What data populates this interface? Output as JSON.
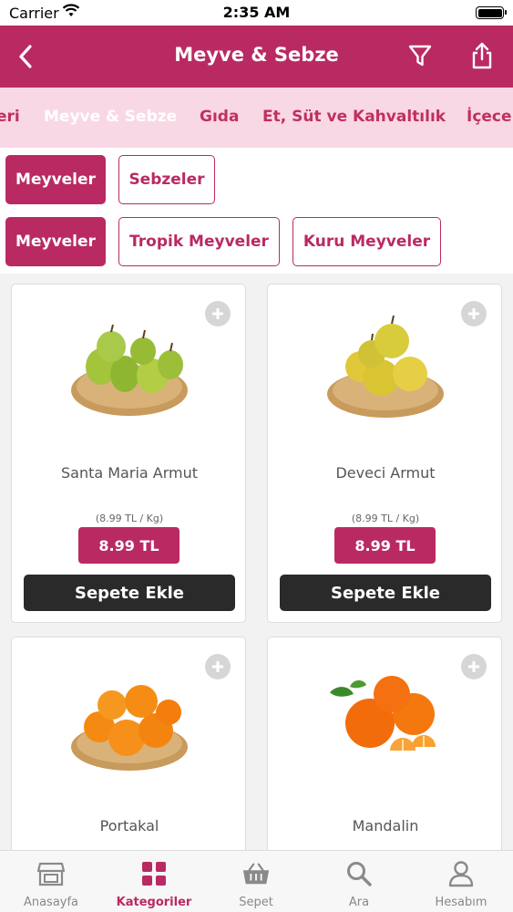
{
  "status_bar": {
    "carrier": "Carrier",
    "time": "2:35 AM"
  },
  "nav": {
    "title": "Meyve & Sebze"
  },
  "categories": [
    "eri",
    "Meyve & Sebze",
    "Gıda",
    "Et, Süt ve Kahvaltılık",
    "İçece"
  ],
  "chips_row1": [
    "Meyveler",
    "Sebzeler"
  ],
  "chips_row2": [
    "Meyveler",
    "Tropik Meyveler",
    "Kuru Meyveler"
  ],
  "products": [
    {
      "name": "Santa Maria Armut",
      "unit_price": "(8.99 TL / Kg)",
      "price": "8.99 TL",
      "add_label": "Sepete Ekle"
    },
    {
      "name": "Deveci Armut",
      "unit_price": "(8.99 TL / Kg)",
      "price": "8.99 TL",
      "add_label": "Sepete Ekle"
    },
    {
      "name": "Portakal"
    },
    {
      "name": "Mandalin"
    }
  ],
  "tabbar": [
    {
      "label": "Anasayfa",
      "icon": "store-icon"
    },
    {
      "label": "Kategoriler",
      "icon": "grid-icon"
    },
    {
      "label": "Sepet",
      "icon": "basket-icon"
    },
    {
      "label": "Ara",
      "icon": "search-icon"
    },
    {
      "label": "Hesabım",
      "icon": "user-icon"
    }
  ],
  "colors": {
    "brand": "#b92a63",
    "strip_bg": "#f9d8e5",
    "dark_button": "#2a2a2a"
  }
}
